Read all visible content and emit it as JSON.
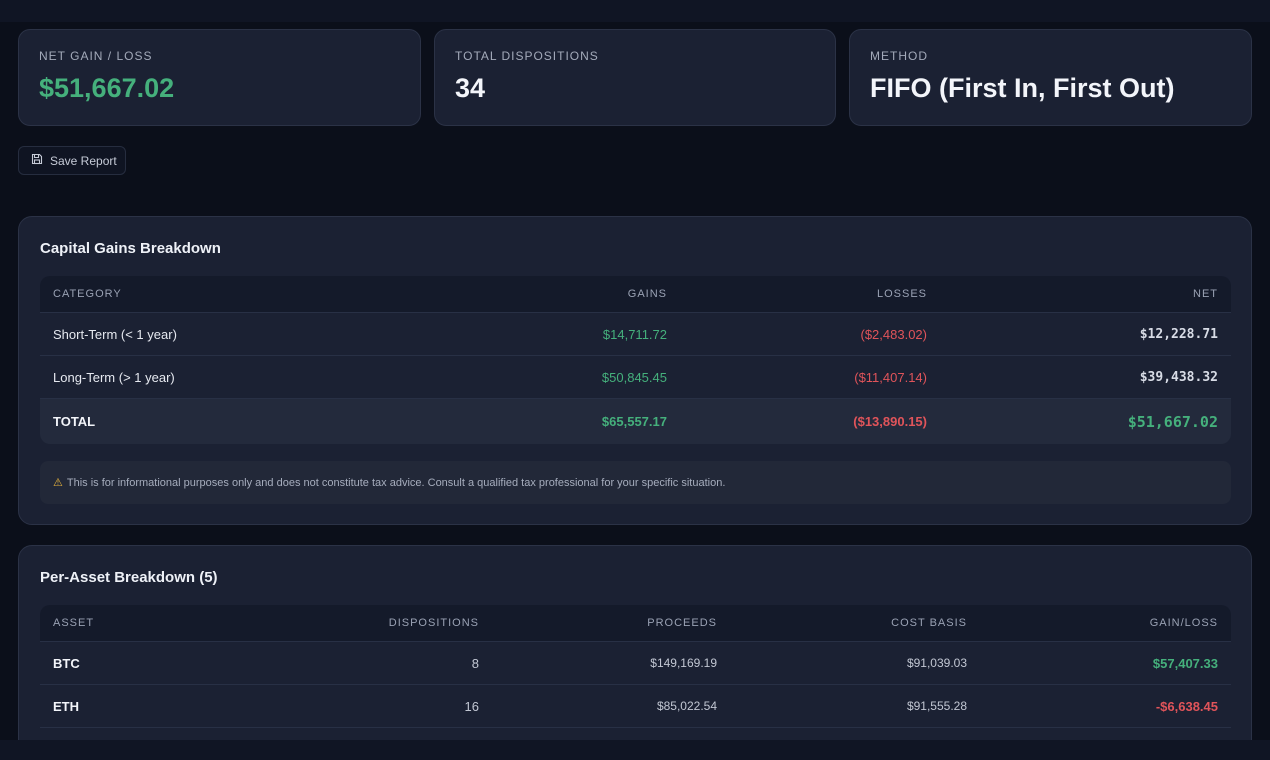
{
  "stats": [
    {
      "label": "NET GAIN / LOSS",
      "value": "$51,667.02"
    },
    {
      "label": "TOTAL DISPOSITIONS",
      "value": "34"
    },
    {
      "label": "METHOD",
      "value": "FIFO (First In, First Out)"
    }
  ],
  "actions": {
    "save_label": "Save Report",
    "save_icon": "save-icon"
  },
  "capital_gains": {
    "title": "Capital Gains Breakdown",
    "headers": [
      "CATEGORY",
      "GAINS",
      "LOSSES",
      "NET"
    ],
    "rows": [
      {
        "category": "Short-Term (< 1 year)",
        "gains": "$14,711.72",
        "losses": "($2,483.02)",
        "net": "$12,228.71"
      },
      {
        "category": "Long-Term (> 1 year)",
        "gains": "$50,845.45",
        "losses": "($11,407.14)",
        "net": "$39,438.32"
      }
    ],
    "total": {
      "category": "TOTAL",
      "gains": "$65,557.17",
      "losses": "($13,890.15)",
      "net": "$51,667.02"
    },
    "disclaimer": "This is for informational purposes only and does not constitute tax advice. Consult a qualified tax professional for your specific situation.",
    "disclaimer_icon": "warning-icon"
  },
  "per_asset": {
    "title": "Per-Asset Breakdown (5)",
    "headers": [
      "ASSET",
      "DISPOSITIONS",
      "PROCEEDS",
      "COST BASIS",
      "GAIN/LOSS"
    ],
    "rows": [
      {
        "asset": "BTC",
        "dispositions": "8",
        "proceeds": "$149,169.19",
        "cost_basis": "$91,039.03",
        "gain_loss": "$57,407.33"
      },
      {
        "asset": "ETH",
        "dispositions": "16",
        "proceeds": "$85,022.54",
        "cost_basis": "$91,555.28",
        "gain_loss": "-$6,638.45"
      }
    ]
  },
  "colors": {
    "positive": "#45b07c",
    "negative": "#e0545a",
    "background": "#0b0f1a",
    "card": "#1b2133"
  }
}
